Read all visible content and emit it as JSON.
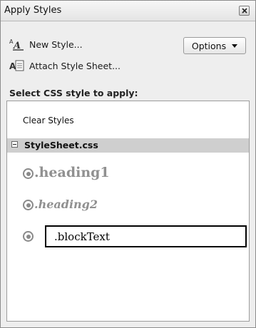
{
  "window": {
    "title": "Apply Styles"
  },
  "actions": {
    "new_style": {
      "label": "New Style...",
      "icon": "new-style-icon"
    },
    "attach_style_sheet": {
      "label": "Attach Style Sheet...",
      "icon": "attach-stylesheet-icon"
    }
  },
  "options_button": {
    "label": "Options"
  },
  "section_label": "Select CSS style to apply:",
  "list": {
    "clear_styles": "Clear Styles",
    "group": {
      "name": "StyleSheet.css",
      "expanded": true
    },
    "styles": [
      {
        "name": ".heading1"
      },
      {
        "name": ".heading2"
      },
      {
        "name": ".blockText",
        "selected": true
      }
    ]
  },
  "colors": {
    "style_preview_gray": "#909090",
    "group_header_bg": "#cfcfcf"
  }
}
